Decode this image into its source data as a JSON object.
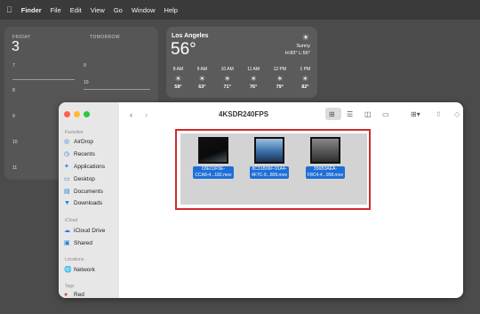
{
  "menubar": {
    "apple_icon": "apple-logo",
    "items": [
      "Finder",
      "File",
      "Edit",
      "View",
      "Go",
      "Window",
      "Help"
    ]
  },
  "calendar": {
    "day_label": "FRIDAY",
    "date": "3",
    "tomorrow_label": "TOMORROW",
    "left_hours": [
      "7",
      "8",
      "9",
      "10",
      "11"
    ],
    "right_hours": [
      "9",
      "10",
      "11",
      "12"
    ]
  },
  "weather": {
    "city": "Los Angeles",
    "temperature": "56°",
    "condition": "Sunny",
    "high_low": "H:83° L:56°",
    "hours": [
      {
        "time": "8 AM",
        "temp": "58°"
      },
      {
        "time": "9 AM",
        "temp": "63°"
      },
      {
        "time": "10 AM",
        "temp": "71°"
      },
      {
        "time": "11 AM",
        "temp": "76°"
      },
      {
        "time": "12 PM",
        "temp": "79°"
      },
      {
        "time": "1 PM",
        "temp": "82°"
      }
    ]
  },
  "finder": {
    "folder_title": "4KSDR240FPS",
    "sidebar": {
      "favorites_label": "Favorites",
      "favorites": [
        "AirDrop",
        "Recents",
        "Applications",
        "Desktop",
        "Documents",
        "Downloads"
      ],
      "icloud_label": "iCloud",
      "icloud": [
        "iCloud Drive",
        "Shared"
      ],
      "locations_label": "Locations",
      "locations": [
        "Network"
      ],
      "tags_label": "Tags",
      "tags": [
        "Red"
      ]
    },
    "files": [
      {
        "name": "03EC0F5E-\nCCA8-4...182.mov"
      },
      {
        "name": "8C31B06F-91A4-\n4F7C-9...809.mov"
      },
      {
        "name": "356B3AEA-\nF8C4-4...958.mov"
      }
    ]
  },
  "colors": {
    "selection_outline": "#d22a2a",
    "file_label_bg": "#1f6fd6",
    "sidebar_icon": "#1e7be6"
  }
}
